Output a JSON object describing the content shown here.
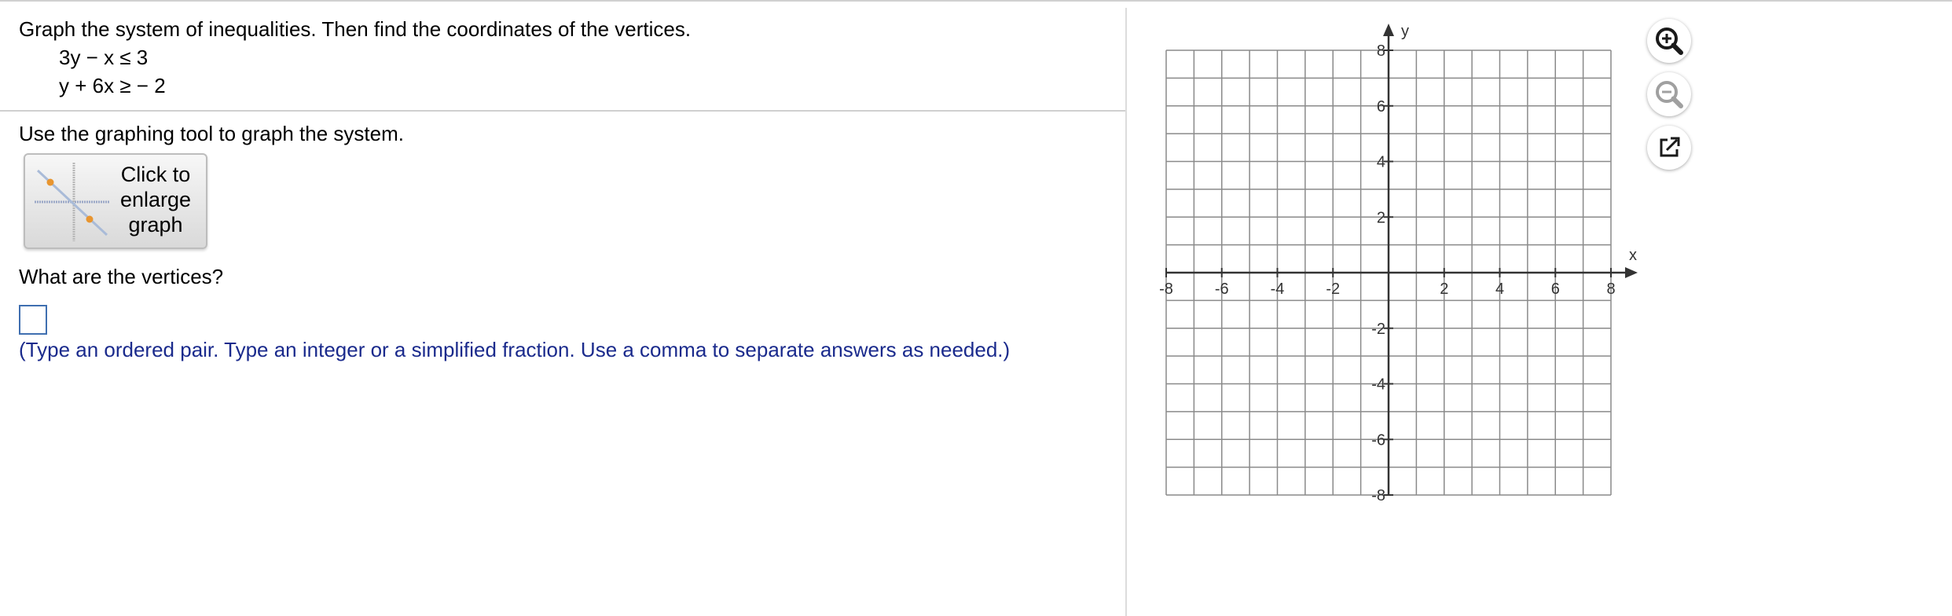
{
  "question": {
    "instruction": "Graph the system of inequalities. Then find the coordinates of the vertices.",
    "inequalities": [
      "3y − x ≤ 3",
      "y + 6x ≥  − 2"
    ]
  },
  "graph_section": {
    "instruction": "Use the graphing tool to graph the system.",
    "enlarge_button_label": "Click to\nenlarge\ngraph"
  },
  "answer": {
    "question": "What are the vertices?",
    "value": "",
    "hint": "(Type an ordered pair. Type an integer or a simplified fraction. Use a comma to separate answers as needed.)"
  },
  "graph": {
    "x_axis_label": "x",
    "y_axis_label": "y",
    "x_range": [
      -8,
      8
    ],
    "y_range": [
      -8,
      8
    ],
    "grid_step": 1,
    "tick_label_step": 2,
    "x_tick_labels": [
      "-8",
      "-6",
      "-4",
      "-2",
      "2",
      "4",
      "6",
      "8"
    ],
    "y_tick_labels": [
      "8",
      "6",
      "4",
      "2",
      "-2",
      "-4",
      "-6",
      "-8"
    ]
  },
  "toolbar": {
    "zoom_in_icon": "zoom-in-icon",
    "zoom_out_icon": "zoom-out-icon",
    "popout_icon": "popout-icon"
  },
  "colors": {
    "hint_text": "#1a2a8c",
    "answer_box_border": "#3f6fb0",
    "grid_line": "#8a8a8a",
    "axis": "#333333"
  }
}
